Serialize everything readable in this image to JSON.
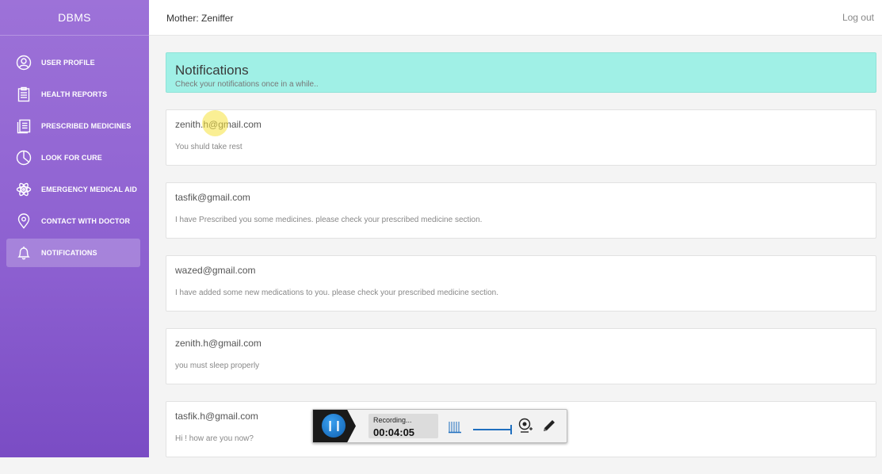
{
  "app": {
    "brand": "DBMS"
  },
  "sidebar": {
    "items": [
      {
        "label": "USER PROFILE",
        "icon": "user-icon",
        "active": false
      },
      {
        "label": "HEALTH REPORTS",
        "icon": "clipboard-icon",
        "active": false
      },
      {
        "label": "PRESCRIBED MEDICINES",
        "icon": "document-stack-icon",
        "active": false
      },
      {
        "label": "LOOK FOR CURE",
        "icon": "pie-chart-icon",
        "active": false
      },
      {
        "label": "EMERGENCY MEDICAL AID",
        "icon": "atom-icon",
        "active": false
      },
      {
        "label": "CONTACT WITH DOCTOR",
        "icon": "location-pin-icon",
        "active": false
      },
      {
        "label": "NOTIFICATIONS",
        "icon": "bell-icon",
        "active": true
      }
    ]
  },
  "topbar": {
    "title": "Mother: Zeniffer",
    "logout": "Log out"
  },
  "page": {
    "title": "Notifications",
    "subtitle": "Check your notifications once in a while.."
  },
  "notifications": [
    {
      "email": "zenith.h@gmail.com",
      "message": "You shuld take rest"
    },
    {
      "email": "tasfik@gmail.com",
      "message": "I have Prescribed you some medicines. please check your prescribed medicine section."
    },
    {
      "email": "wazed@gmail.com",
      "message": "I have added some new medications to you. please check your prescribed medicine section."
    },
    {
      "email": "zenith.h@gmail.com",
      "message": "you must sleep properly"
    },
    {
      "email": "tasfik.h@gmail.com",
      "message": "Hi ! how are you now?"
    }
  ],
  "recorder": {
    "status": "Recording...",
    "time": "00:04:05"
  },
  "colors": {
    "sidebar": "#8c5fd0",
    "banner": "#a0f0e6",
    "accent_blue": "#1f6fbf"
  }
}
